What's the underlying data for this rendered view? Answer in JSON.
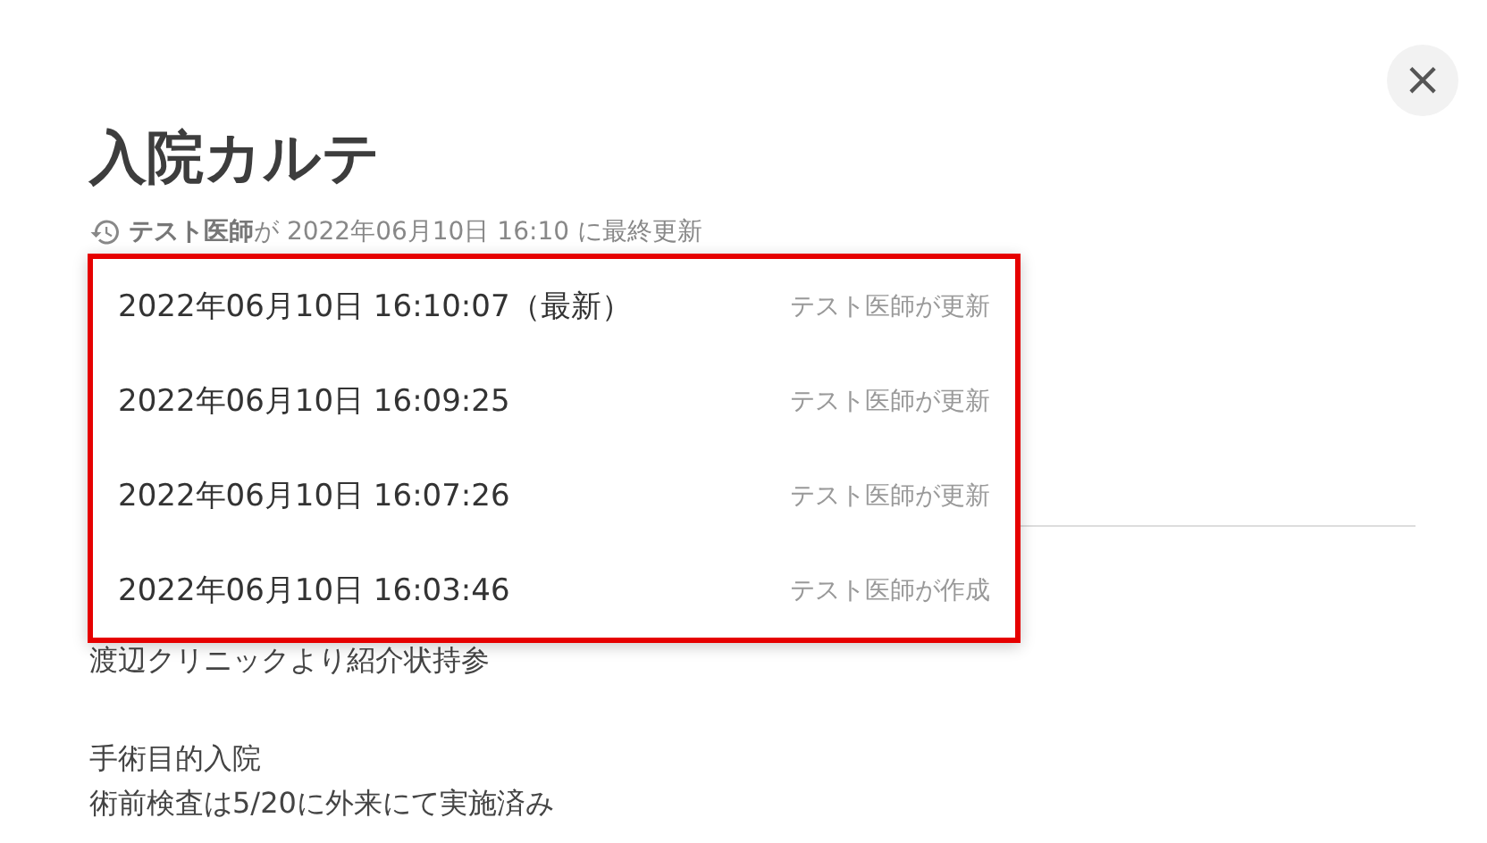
{
  "title": "入院カルテ",
  "last_updated": "**テスト医師**が 2022年06月10日 16:10 に最終更新",
  "close_button": {
    "label": "×"
  },
  "history_menu": [
    {
      "timestamp": "2022年06月10日 16:10:07（最新）",
      "action": "テスト医師が更新"
    },
    {
      "timestamp": "2022年06月10日 16:09:25",
      "action": "テスト医師が更新"
    },
    {
      "timestamp": "2022年06月10日 16:07:26",
      "action": "テスト医師が更新"
    },
    {
      "timestamp": "2022年06月10日 16:03:46",
      "action": "テスト医師が作成"
    }
  ],
  "body_paragraphs": [
    [
      "渡辺クリニックより紹介状持参"
    ],
    [
      "手術目的入院",
      "術前検査は5/20に外来にて実施済み"
    ]
  ]
}
